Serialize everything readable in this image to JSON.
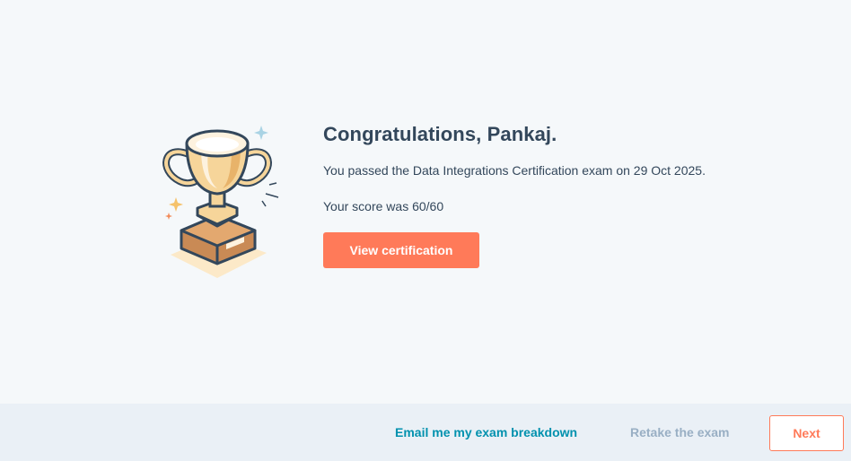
{
  "result": {
    "title": "Congratulations, Pankaj.",
    "passed_message": "You passed the Data Integrations Certification exam on 29 Oct 2025.",
    "score_message": "Your score was 60/60",
    "view_button_label": "View certification",
    "illustration_icon": "trophy-icon"
  },
  "footer": {
    "email_link_label": "Email me my exam breakdown",
    "retake_link_label": "Retake the exam",
    "next_button_label": "Next"
  },
  "colors": {
    "accent": "#ff7a59",
    "link": "#0091ae",
    "text": "#33475b",
    "disabled": "#99afc4",
    "background": "#f5f8fa",
    "footer_background": "#eaf0f6"
  }
}
